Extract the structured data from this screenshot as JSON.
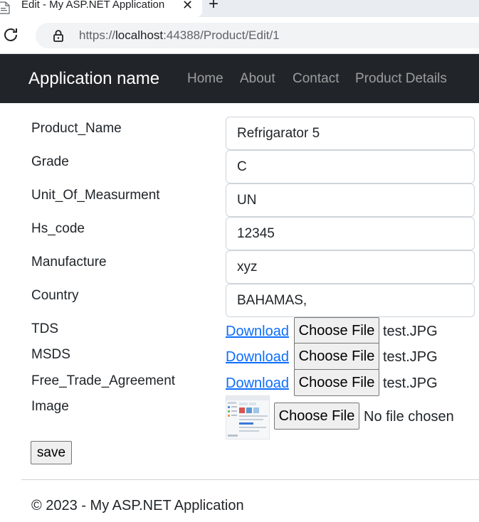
{
  "browser": {
    "tab_title": "Edit - My ASP.NET Application",
    "tab_close_icon": "close-icon",
    "new_tab_icon": "plus-icon",
    "reload_icon": "reload-icon",
    "lock_icon": "lock-icon",
    "url_scheme": "https://",
    "url_host": "localhost",
    "url_rest": ":44388/Product/Edit/1"
  },
  "navbar": {
    "brand": "Application name",
    "links": [
      "Home",
      "About",
      "Contact",
      "Product Details"
    ]
  },
  "form": {
    "fields": [
      {
        "label": "Product_Name",
        "value": "Refrigarator 5"
      },
      {
        "label": "Grade",
        "value": "C"
      },
      {
        "label": "Unit_Of_Measurment",
        "value": "UN"
      },
      {
        "label": "Hs_code",
        "value": "12345"
      },
      {
        "label": "Manufacture",
        "value": "xyz"
      },
      {
        "label": "Country",
        "value": "BAHAMAS,"
      }
    ],
    "files": [
      {
        "label": "TDS",
        "link": "Download",
        "button": "Choose File",
        "file": "test.JPG"
      },
      {
        "label": "MSDS",
        "link": "Download",
        "button": "Choose File",
        "file": "test.JPG"
      },
      {
        "label": "Free_Trade_Agreement",
        "link": "Download",
        "button": "Choose File",
        "file": "test.JPG"
      }
    ],
    "image": {
      "label": "Image",
      "button": "Choose File",
      "file": "No file chosen"
    },
    "save": "save"
  },
  "footer": "© 2023 - My ASP.NET Application",
  "colors": {
    "navbar_bg": "#212529",
    "link": "#0d6efd"
  }
}
